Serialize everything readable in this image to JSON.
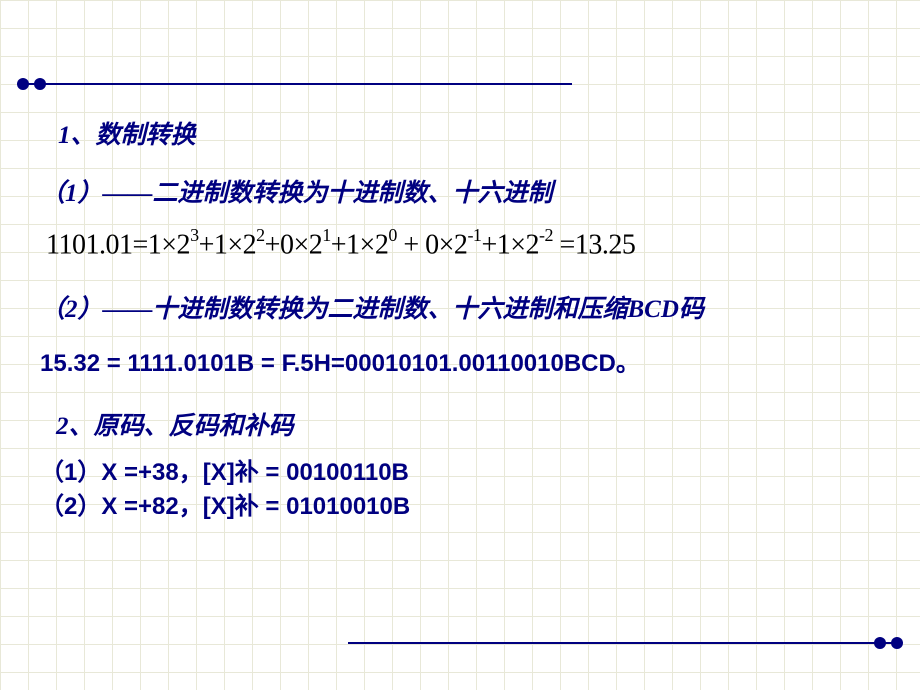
{
  "section1": {
    "title": "1、数制转换",
    "sub1_title": "（1）——二进制数转换为十进制数、十六进制",
    "equation_parts": {
      "lhs": "1101.01=",
      "t1a": "1×2",
      "t1e": "3",
      "t2a": "+1×2",
      "t2e": "2",
      "t3a": "+0×2",
      "t3e": "1",
      "t4a": "+1×2",
      "t4e": "0",
      "t5a": " + 0×2",
      "t5e": "-1",
      "t6a": "+1×2",
      "t6e": "-2",
      "rhs": " =13.25"
    },
    "sub2_title": "（2）——十进制数转换为二进制数、十六进制和压缩BCD码",
    "formula": "15.32 = 1111.0101B = F.5H=00010101.00110010BCD。"
  },
  "section2": {
    "title": "2、原码、反码和补码",
    "line1": "（1）X =+38，[X]补 = 00100110B",
    "line2": "（2）X =+82，[X]补 = 01010010B"
  }
}
